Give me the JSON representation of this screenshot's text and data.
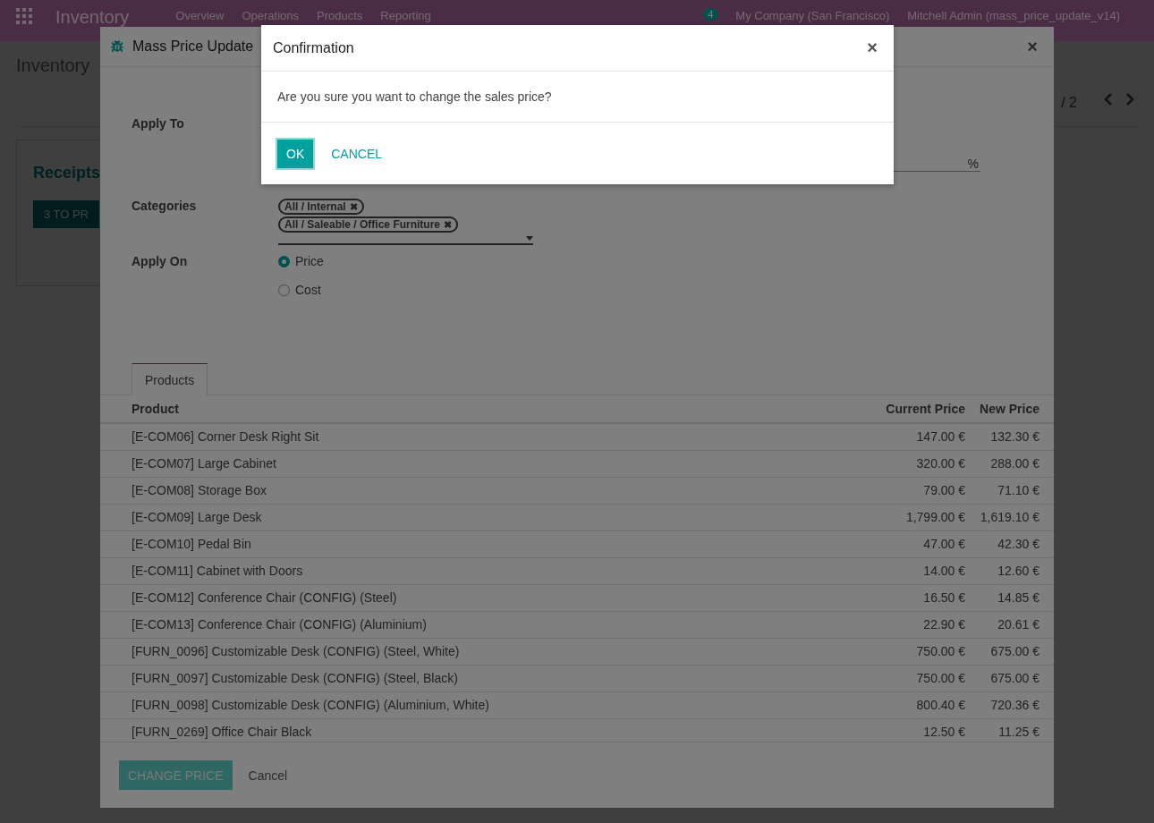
{
  "navbar": {
    "app": "Inventory",
    "menu": [
      "Overview",
      "Operations",
      "Products",
      "Reporting"
    ],
    "badge": "4",
    "company": "My Company (San Francisco)",
    "user": "Mitchell Admin (mass_price_update_v14)"
  },
  "breadcrumb": "Inventory",
  "pager": "/ 2",
  "card": {
    "title": "Receipts",
    "button": "3 TO PR"
  },
  "mass_dialog": {
    "title": "Mass Price Update",
    "close": "×",
    "apply_to": {
      "label": "Apply To"
    },
    "percent_unit": "%",
    "categories": {
      "label": "Categories",
      "tags": [
        {
          "label": "All / Internal",
          "remove": "✖"
        },
        {
          "label": "All / Saleable / Office Furniture",
          "remove": "✖"
        }
      ]
    },
    "apply_on": {
      "label": "Apply On",
      "options": [
        {
          "label": "Price",
          "selected": true
        },
        {
          "label": "Cost",
          "selected": false
        }
      ]
    },
    "tabs": [
      {
        "label": "Products",
        "selected": true
      }
    ],
    "table": {
      "columns": [
        "Product",
        "Current Price",
        "New Price"
      ],
      "rows": [
        [
          "[E-COM06] Corner Desk Right Sit",
          "147.00 €",
          "132.30 €"
        ],
        [
          "[E-COM07] Large Cabinet",
          "320.00 €",
          "288.00 €"
        ],
        [
          "[E-COM08] Storage Box",
          "79.00 €",
          "71.10 €"
        ],
        [
          "[E-COM09] Large Desk",
          "1,799.00 €",
          "1,619.10 €"
        ],
        [
          "[E-COM10] Pedal Bin",
          "47.00 €",
          "42.30 €"
        ],
        [
          "[E-COM11] Cabinet with Doors",
          "14.00 €",
          "12.60 €"
        ],
        [
          "[E-COM12] Conference Chair (CONFIG) (Steel)",
          "16.50 €",
          "14.85 €"
        ],
        [
          "[E-COM13] Conference Chair (CONFIG) (Aluminium)",
          "22.90 €",
          "20.61 €"
        ],
        [
          "[FURN_0096] Customizable Desk (CONFIG) (Steel, White)",
          "750.00 €",
          "675.00 €"
        ],
        [
          "[FURN_0097] Customizable Desk (CONFIG) (Steel, Black)",
          "750.00 €",
          "675.00 €"
        ],
        [
          "[FURN_0098] Customizable Desk (CONFIG) (Aluminium, White)",
          "800.40 €",
          "720.36 €"
        ],
        [
          "[FURN_0269] Office Chair Black",
          "12.50 €",
          "11.25 €"
        ]
      ]
    },
    "buttons": [
      "CHANGE PRICE",
      "Cancel"
    ]
  },
  "confirm": {
    "title": "Confirmation",
    "close": "×",
    "message": "Are you sure you want to change the sales price?",
    "buttons": [
      "OK",
      "CANCEL"
    ]
  }
}
